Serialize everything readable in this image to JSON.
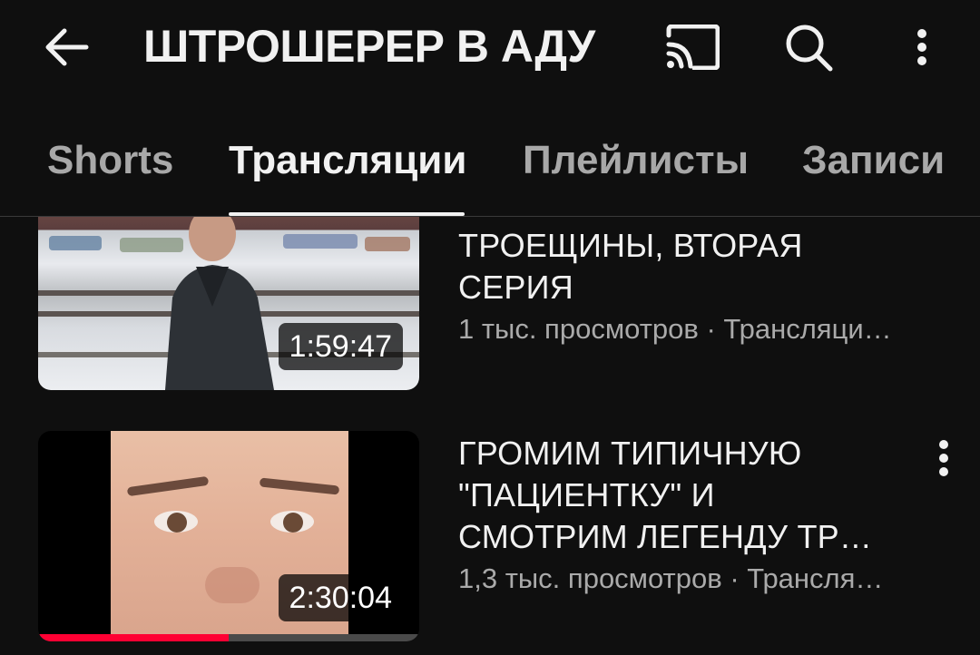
{
  "header": {
    "title": "ШТРОШЕРЕР В АДУ",
    "back_icon": "arrow-left-icon",
    "cast_icon": "cast-icon",
    "search_icon": "search-icon",
    "more_icon": "more-vertical-icon"
  },
  "tabs": [
    {
      "label": "Shorts",
      "active": false
    },
    {
      "label": "Трансляции",
      "active": true
    },
    {
      "label": "Плейлисты",
      "active": false
    },
    {
      "label": "Записи",
      "active": false
    }
  ],
  "videos": [
    {
      "title_lines": [
        "ТРОЕЩИНЫ, ВТОРАЯ",
        "СЕРИЯ"
      ],
      "meta": "1 тыс. просмотров · Трансляци…",
      "duration": "1:59:47",
      "progress": null
    },
    {
      "title_lines": [
        "ГРОМИМ ТИПИЧНУЮ",
        "\"ПАЦИЕНТКУ\" И",
        "СМОТРИМ ЛЕГЕНДУ ТР…"
      ],
      "meta": "1,3 тыс. просмотров · Трансля…",
      "duration": "2:30:04",
      "progress": 0.5
    }
  ],
  "colors": {
    "background": "#0f0f0f",
    "text_primary": "#f1f1f1",
    "text_secondary": "#aaaaaa",
    "progress": "#ff0033"
  }
}
